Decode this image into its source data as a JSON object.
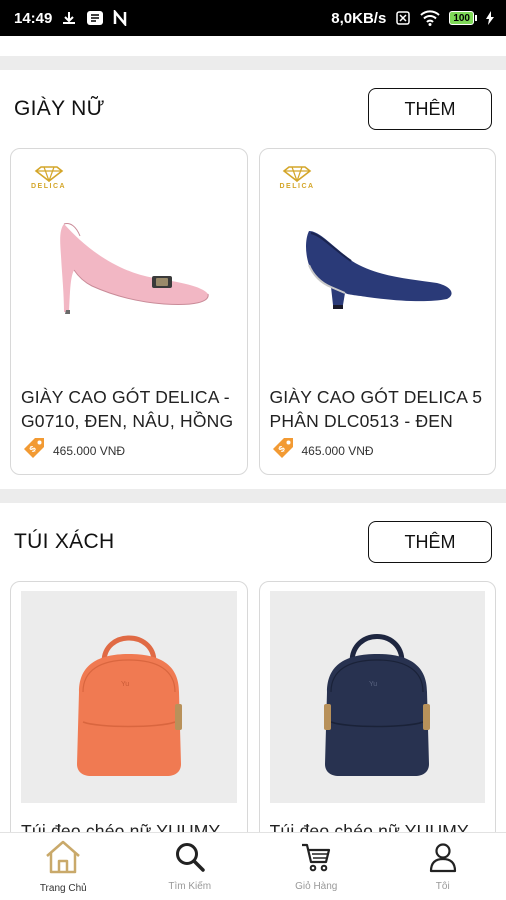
{
  "status_bar": {
    "time": "14:49",
    "network_speed": "8,0KB/s",
    "battery": "100"
  },
  "sections": [
    {
      "title": "GIÀY NỮ",
      "more_label": "THÊM",
      "products": [
        {
          "brand": "DELICA",
          "name": "GIÀY CAO GÓT DELICA - G0710, ĐEN, NÂU, HỒNG",
          "price": "465.000 VNĐ"
        },
        {
          "brand": "DELICA",
          "name": "GIÀY CAO GÓT DELICA 5 PHÂN DLC0513 - ĐEN",
          "price": "465.000 VNĐ"
        }
      ]
    },
    {
      "title": "TÚI XÁCH",
      "more_label": "THÊM",
      "products": [
        {
          "name": "Túi đeo chéo nữ YUUMY"
        },
        {
          "name": "Túi đeo chéo nữ YUUMY"
        }
      ]
    }
  ],
  "tabs": [
    {
      "label": "Trang Chủ",
      "icon": "home-icon",
      "active": true
    },
    {
      "label": "Tìm Kiếm",
      "icon": "search-icon",
      "active": false
    },
    {
      "label": "Giỏ Hàng",
      "icon": "cart-icon",
      "active": false
    },
    {
      "label": "Tôi",
      "icon": "user-icon",
      "active": false
    }
  ],
  "colors": {
    "brand_gold": "#d4a62a",
    "price_tag": "#f29a33",
    "shoe_pink": "#f2b7c4",
    "shoe_navy": "#2a3a78",
    "bag_orange": "#f07a52",
    "bag_navy": "#283250"
  }
}
